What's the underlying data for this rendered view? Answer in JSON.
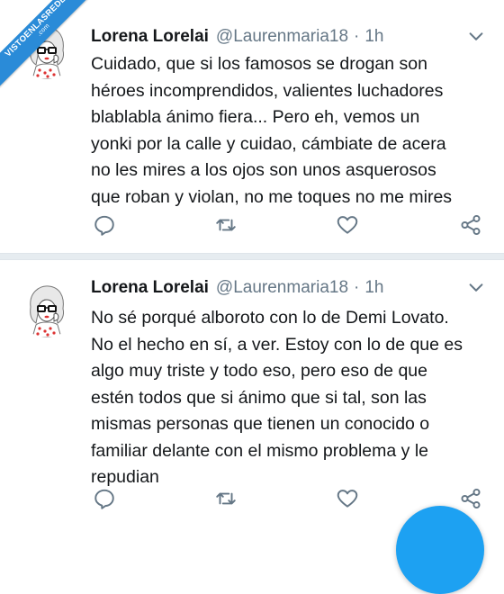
{
  "watermark": {
    "main": "VISTOENLASREDES",
    "sub": ".com"
  },
  "colors": {
    "accent": "#1da1f2",
    "muted": "#657786",
    "text": "#14171a",
    "separator": "#e6ecf0"
  },
  "tweets": [
    {
      "name": "Lorena Lorelai",
      "handle": "@Laurenmaria18",
      "separator": "·",
      "time": "1h",
      "lines": [
        "Cuidado, que si los famosos se drogan son",
        "héroes incomprendidos, valientes luchadores",
        "blablabla ánimo fiera... Pero eh, vemos un",
        "yonki por la calle y cuidao, cámbiate de acera",
        "no les mires a los ojos son unos asquerosos",
        "que roban y violan, no me toques no me mires"
      ],
      "actions": [
        "reply-icon",
        "retweet-icon",
        "like-icon",
        "share-icon"
      ]
    },
    {
      "name": "Lorena Lorelai",
      "handle": "@Laurenmaria18",
      "separator": "·",
      "time": "1h",
      "lines": [
        "No sé porqué alboroto con lo de Demi Lovato.",
        "No el hecho en sí, a ver. Estoy con lo de que es",
        "algo muy triste y todo eso, pero eso de que",
        "estén todos que si ánimo que si tal, son las",
        "mismas personas que tienen un conocido o",
        "familiar delante con el mismo problema y le",
        "repudian"
      ],
      "actions": [
        "reply-icon",
        "retweet-icon",
        "like-icon",
        "share-icon"
      ]
    }
  ]
}
